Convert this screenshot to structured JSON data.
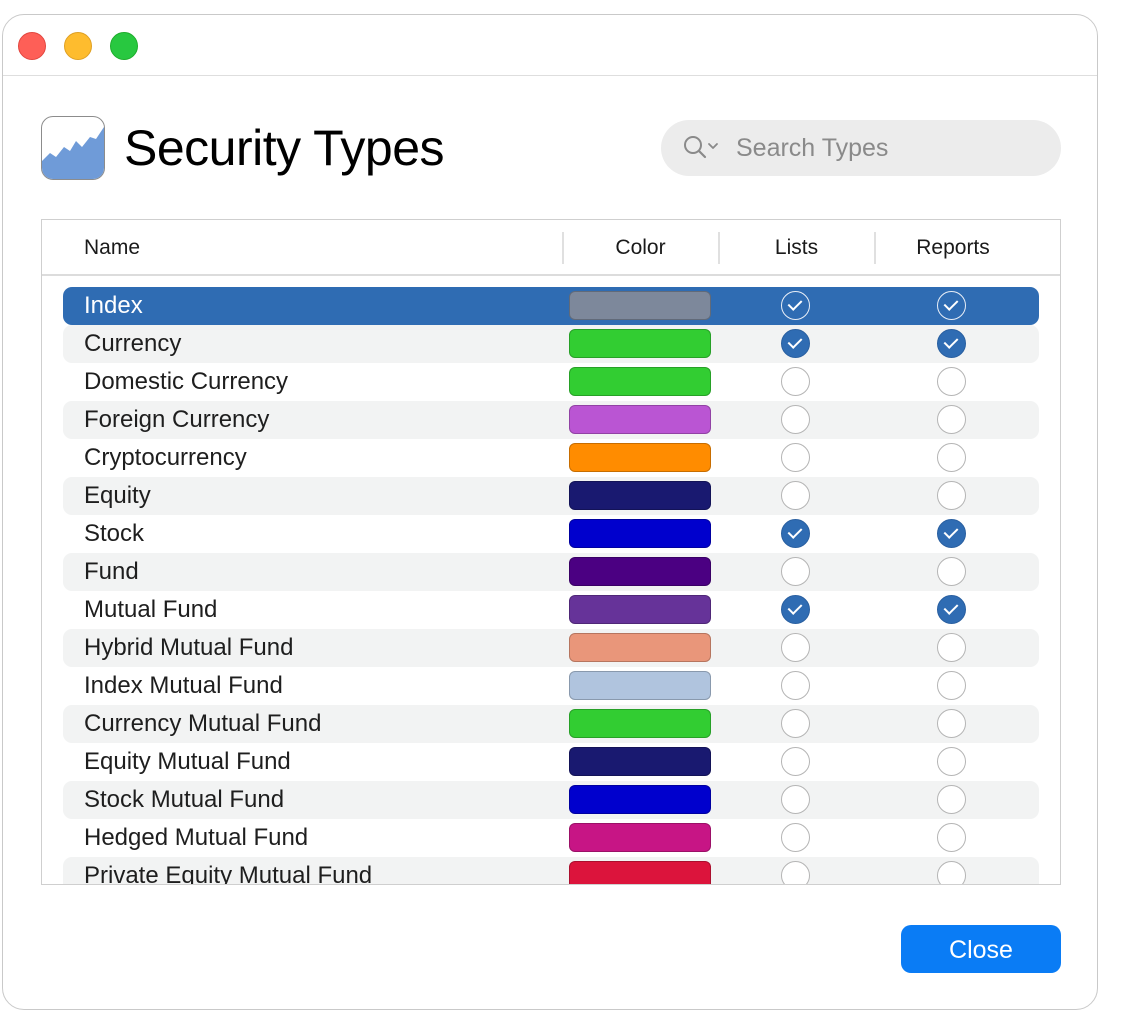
{
  "window": {
    "controls": [
      "close",
      "minimize",
      "zoom"
    ]
  },
  "header": {
    "title": "Security Types",
    "icon": "area-chart-icon"
  },
  "search": {
    "placeholder": "Search Types",
    "icon": "search-icon"
  },
  "table": {
    "columns": {
      "name": "Name",
      "color": "Color",
      "lists": "Lists",
      "reports": "Reports"
    },
    "selected_row": "Index",
    "rows": [
      {
        "name": "Index",
        "color": "#7d889b",
        "lists": true,
        "reports": true
      },
      {
        "name": "Currency",
        "color": "#32cd32",
        "lists": true,
        "reports": true
      },
      {
        "name": "Domestic Currency",
        "color": "#32cd32",
        "lists": false,
        "reports": false
      },
      {
        "name": "Foreign Currency",
        "color": "#ba55d3",
        "lists": false,
        "reports": false
      },
      {
        "name": "Cryptocurrency",
        "color": "#ff8c00",
        "lists": false,
        "reports": false
      },
      {
        "name": "Equity",
        "color": "#191970",
        "lists": false,
        "reports": false
      },
      {
        "name": "Stock",
        "color": "#0000cd",
        "lists": true,
        "reports": true
      },
      {
        "name": "Fund",
        "color": "#4b0082",
        "lists": false,
        "reports": false
      },
      {
        "name": "Mutual Fund",
        "color": "#663399",
        "lists": true,
        "reports": true
      },
      {
        "name": "Hybrid Mutual Fund",
        "color": "#e9967a",
        "lists": false,
        "reports": false
      },
      {
        "name": "Index Mutual Fund",
        "color": "#b0c4de",
        "lists": false,
        "reports": false
      },
      {
        "name": "Currency Mutual Fund",
        "color": "#32cd32",
        "lists": false,
        "reports": false
      },
      {
        "name": "Equity Mutual Fund",
        "color": "#191970",
        "lists": false,
        "reports": false
      },
      {
        "name": "Stock Mutual Fund",
        "color": "#0000cd",
        "lists": false,
        "reports": false
      },
      {
        "name": "Hedged Mutual Fund",
        "color": "#c71585",
        "lists": false,
        "reports": false
      },
      {
        "name": "Private Equity Mutual Fund",
        "color": "#dc143c",
        "lists": false,
        "reports": false
      }
    ]
  },
  "footer": {
    "close_label": "Close"
  },
  "colors": {
    "accent": "#2f6cb3",
    "button": "#0a7cf5"
  }
}
